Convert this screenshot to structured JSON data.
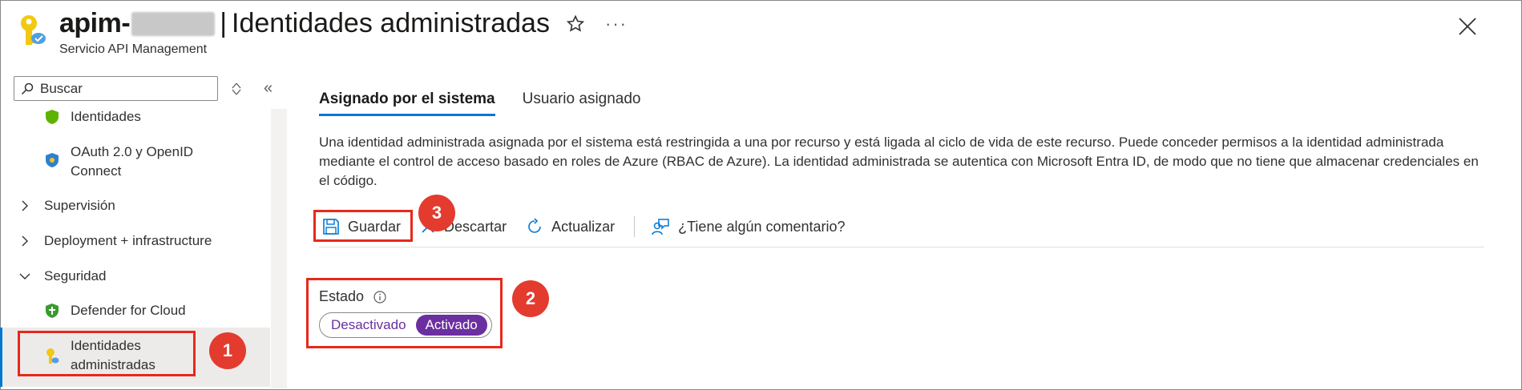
{
  "header": {
    "title_prefix": "apim-",
    "separator": "|",
    "page_title": "Identidades administradas",
    "subtitle": "Servicio API Management",
    "more_label": "···"
  },
  "sidebar": {
    "search_placeholder": "Buscar",
    "collapse_label": "«",
    "items": [
      {
        "label": "Identidades"
      },
      {
        "label": "OAuth 2.0 y OpenID",
        "label2": "Connect"
      },
      {
        "label": "Supervisión"
      },
      {
        "label": "Deployment + infrastructure"
      },
      {
        "label": "Seguridad"
      },
      {
        "label": "Defender for Cloud"
      },
      {
        "label": "Identidades",
        "label2": "administradas"
      }
    ]
  },
  "tabs": [
    {
      "label": "Asignado por el sistema",
      "active": true
    },
    {
      "label": "Usuario asignado",
      "active": false
    }
  ],
  "description": "Una identidad administrada asignada por el sistema está restringida a una por recurso y está ligada al ciclo de vida de este recurso. Puede conceder permisos a la identidad administrada mediante el control de acceso basado en roles de Azure (RBAC de Azure). La identidad administrada se autentica con Microsoft Entra ID, de modo que no tiene que almacenar credenciales en el código.",
  "toolbar": {
    "save": "Guardar",
    "discard": "Descartar",
    "refresh": "Actualizar",
    "feedback": "¿Tiene algún comentario?"
  },
  "status": {
    "label": "Estado",
    "off": "Desactivado",
    "on": "Activado",
    "value": "Activado"
  },
  "annotations": {
    "badge1": "1",
    "badge2": "2",
    "badge3": "3"
  },
  "colors": {
    "accent": "#0078d4",
    "toggle_on": "#6b2fa0",
    "annotation": "#e8281b"
  }
}
